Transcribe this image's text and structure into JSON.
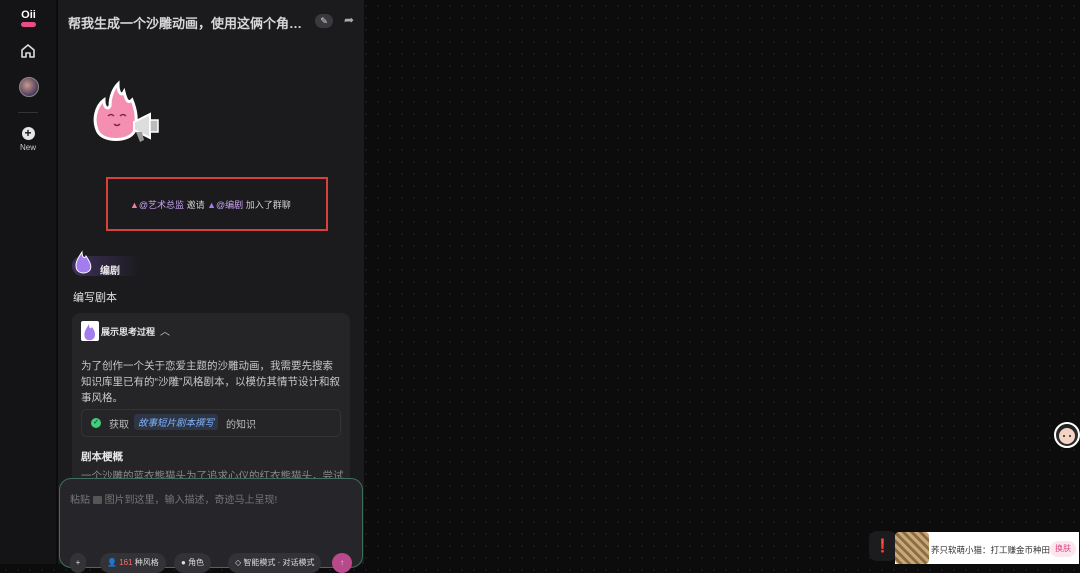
{
  "app": {
    "logo_text": "Oii"
  },
  "rail": {
    "new_label": "New"
  },
  "conversation": {
    "title": "帮我生成一个沙雕动画，使用这俩个角色..."
  },
  "join_notice": {
    "inviter": "@艺术总监",
    "verb": "邀请",
    "invitee": "@编剧",
    "suffix": "加入了群聊"
  },
  "agent": {
    "name": "编剧",
    "task": "编写剧本"
  },
  "thinking": {
    "toggle_label": "展示思考过程",
    "body": "为了创作一个关于恋爱主题的沙雕动画，我需要先搜索知识库里已有的“沙雕”风格剧本，以模仿其情节设计和叙事风格。",
    "kb_prefix": "获取",
    "kb_name": "故事短片剧本撰写",
    "kb_suffix": "的知识"
  },
  "outline": {
    "title": "剧本梗概",
    "preview": "一个沙雕的蓝衣熊猫头为了追求心仪的红衣熊猫头，尝试"
  },
  "composer": {
    "placeholder_a": "粘贴",
    "placeholder_b": "图片到这里，输入描述，奇迹马上呈现!",
    "add_label": "+",
    "grid_count": "161",
    "grid_label": "种风格",
    "role_label": "角色",
    "mode_a": "智能模式",
    "mode_b": "对话模式",
    "send_label": "↑"
  },
  "notification": {
    "text": "荞只软萌小猫：打工赚金币种田",
    "action": "换肤"
  },
  "colors": {
    "accent": "#e84d8a",
    "highlight_border": "#d8403a",
    "kb_chip": "#7fb3ff",
    "agent_purple": "#a37cf0"
  }
}
